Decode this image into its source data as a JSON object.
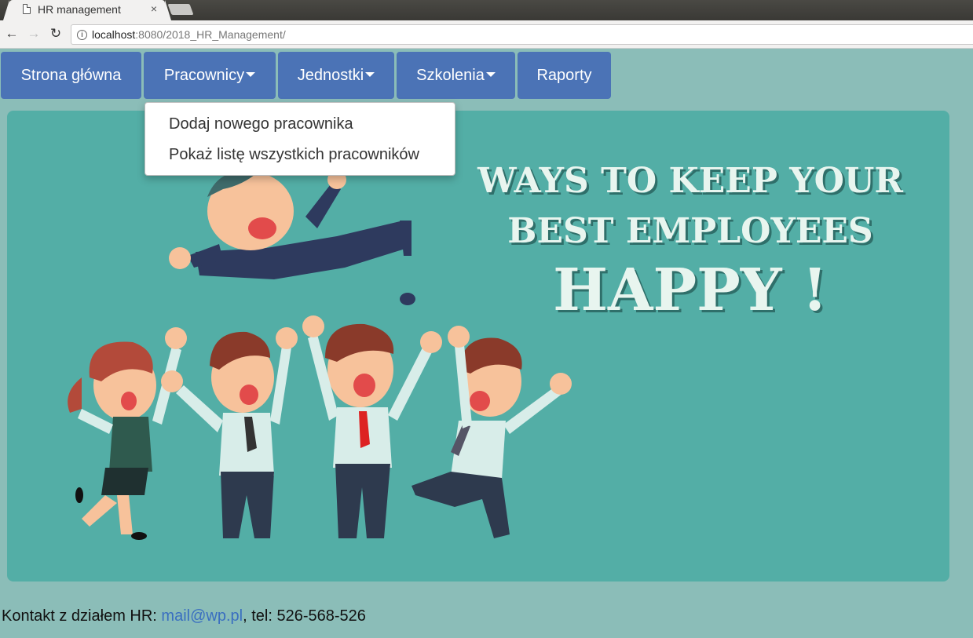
{
  "browser": {
    "tab_title": "HR management",
    "tab_close": "×",
    "url_host": "localhost",
    "url_path": ":8080/2018_HR_Management/",
    "back": "←",
    "forward": "→",
    "reload": "↻"
  },
  "nav": {
    "items": [
      {
        "label": "Strona główna",
        "dropdown": false
      },
      {
        "label": "Pracownicy",
        "dropdown": true
      },
      {
        "label": "Jednostki",
        "dropdown": true
      },
      {
        "label": "Szkolenia",
        "dropdown": true
      },
      {
        "label": "Raporty",
        "dropdown": false
      }
    ],
    "color": "#4b73b6"
  },
  "dropdown": {
    "items": [
      {
        "label": "Dodaj nowego pracownika"
      },
      {
        "label": "Pokaż listę wszystkich pracowników"
      }
    ]
  },
  "banner": {
    "line1": "WAYS TO KEEP YOUR",
    "line2": "BEST EMPLOYEES",
    "line3": "HAPPY !",
    "background": "#53aea6"
  },
  "footer": {
    "prefix": "Kontakt z działem HR: ",
    "email": "mail@wp.pl",
    "suffix": ", tel: 526-568-526"
  }
}
